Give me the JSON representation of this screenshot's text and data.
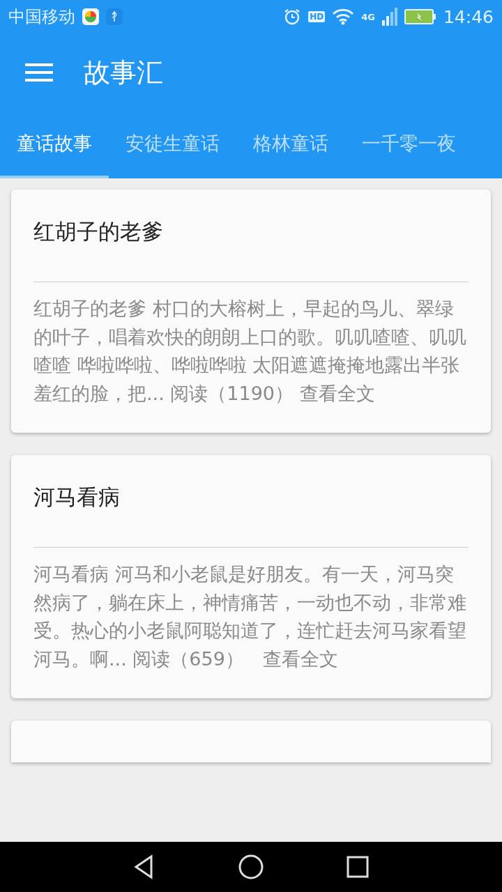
{
  "status_bar": {
    "carrier": "中国移动",
    "network": "4G",
    "time": "14:46",
    "hd": "HD"
  },
  "app_bar": {
    "title": "故事汇"
  },
  "tabs": [
    {
      "label": "童话故事",
      "selected": true
    },
    {
      "label": "安徒生童话",
      "selected": false
    },
    {
      "label": "格林童话",
      "selected": false
    },
    {
      "label": "一千零一夜",
      "selected": false
    }
  ],
  "stories": [
    {
      "title": "红胡子的老爹",
      "summary": "红胡子的老爹 村口的大榕树上，早起的鸟儿、翠绿的叶子，唱着欢快的朗朗上口的歌。叽叽喳喳、叽叽喳喳 哗啦哗啦、哗啦哗啦 太阳遮遮掩掩地露出半张羞红的脸，把... 阅读（1190） 查看全文"
    },
    {
      "title": "河马看病",
      "summary": "河马看病 河马和小老鼠是好朋友。有一天，河马突然病了，躺在床上，神情痛苦，一动也不动，非常难受。热心的小老鼠阿聪知道了，连忙赶去河马家看望河马。啊... 阅读（659）　查看全文"
    }
  ]
}
